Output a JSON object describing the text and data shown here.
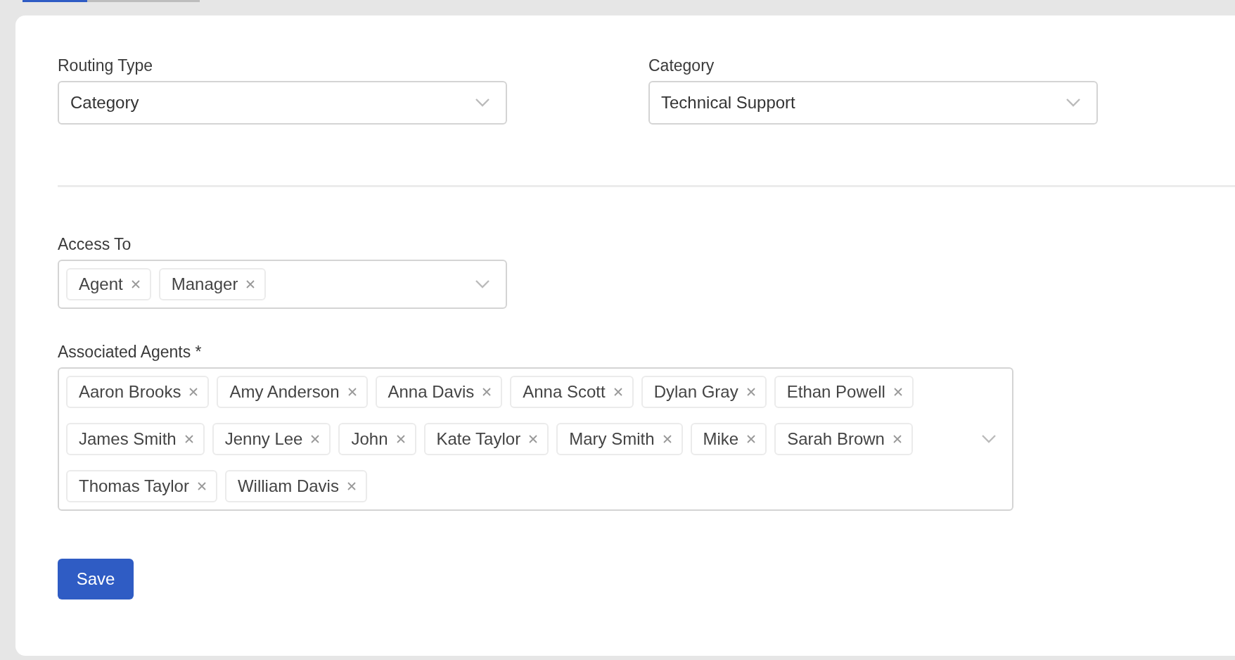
{
  "tabs": [
    {
      "selected": true
    },
    {
      "selected": false
    }
  ],
  "fields": [
    {
      "kind": "select",
      "label": "Routing Type",
      "value": "Category"
    },
    {
      "kind": "select",
      "label": "Category",
      "value": "Technical Support"
    }
  ],
  "access_to": {
    "label": "Access To",
    "tags": [
      "Agent",
      "Manager"
    ]
  },
  "associated_agents": {
    "label": "Associated Agents *",
    "tags": [
      "Aaron Brooks",
      "Amy Anderson",
      "Anna Davis",
      "Anna Scott",
      "Dylan Gray",
      "Ethan Powell",
      "James Smith",
      "Jenny Lee",
      "John",
      "Kate Taylor",
      "Mary Smith",
      "Mike",
      "Sarah Brown",
      "Thomas Taylor",
      "William Davis"
    ]
  },
  "save_button": "Save"
}
